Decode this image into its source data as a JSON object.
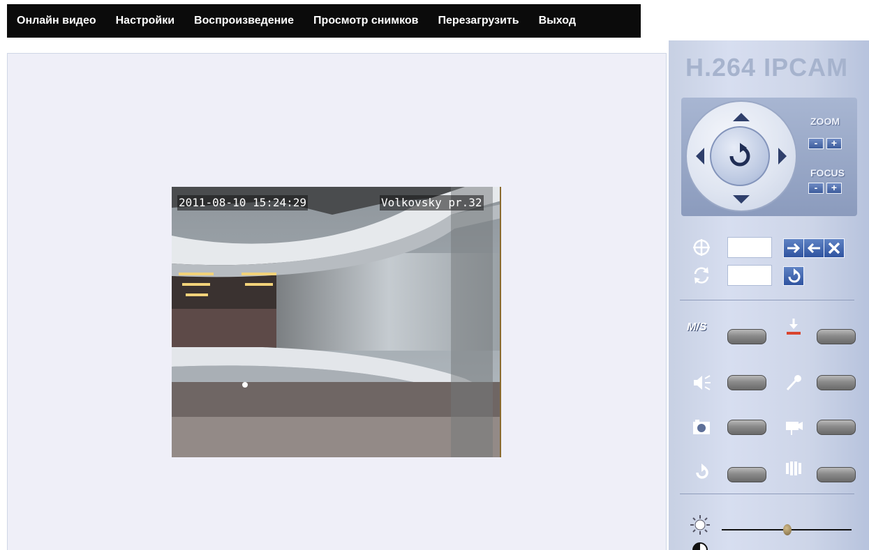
{
  "menu": {
    "items": [
      {
        "label": "Онлайн видео"
      },
      {
        "label": "Настройки"
      },
      {
        "label": "Воспроизведение"
      },
      {
        "label": "Просмотр снимков"
      },
      {
        "label": "Перезагрузить"
      },
      {
        "label": "Выход"
      }
    ]
  },
  "video": {
    "timestamp": "2011-08-10 15:24:29",
    "location": "Volkovsky pr.32"
  },
  "panel": {
    "brand": "H.264 IPCAM",
    "zoom_label": "ZOOM",
    "focus_label": "FOCUS",
    "minus": "-",
    "plus": "+",
    "ms_label": "M/S",
    "preset_value": "",
    "cruise_value": ""
  },
  "colors": {
    "menubar": "#0b0b0b",
    "viewer_bg": "#efeff8",
    "panel_bg": "#cdd5e8",
    "button_blue": "#3d5c9c"
  },
  "slider": {
    "brightness_level": 0.5
  }
}
